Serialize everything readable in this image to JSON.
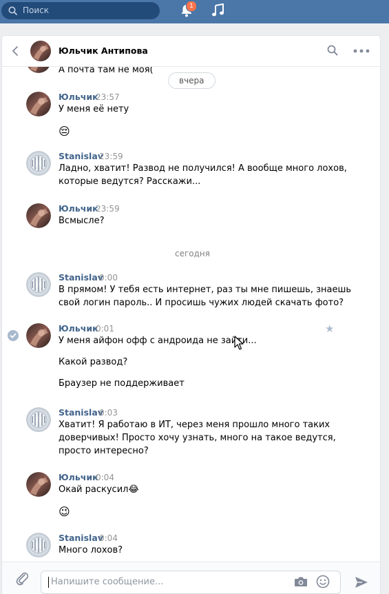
{
  "topbar": {
    "search_placeholder": "Поиск",
    "notifications_badge": "1",
    "icons": [
      "search-icon",
      "bell-icon",
      "music-icon"
    ]
  },
  "chat": {
    "title": "Юльчик Антипова",
    "icons": [
      "back-arrow-icon",
      "search-icon",
      "more-icon"
    ]
  },
  "messages": {
    "partial_top_text": "А почта там не моя(",
    "date_yesterday": "вчера",
    "m1": {
      "author": "Юльчик",
      "time": "23:57",
      "lines": [
        "У меня её нету",
        "😔"
      ]
    },
    "m2": {
      "author": "Stanislav",
      "time": "23:59",
      "lines": [
        "Ладно, хватит! Развод не получился! А вообще много лохов,",
        "которые ведутся? Расскажи..."
      ]
    },
    "m3": {
      "author": "Юльчик",
      "time": "23:59",
      "lines": [
        "Всмысле?"
      ]
    },
    "date_today": "сегодня",
    "m4": {
      "author": "Stanislav",
      "time": "0:00",
      "lines": [
        "В прямом! У тебя есть интернет, раз ты мне пишешь, знаешь",
        "свой логин пароль.. И просишь чужих людей скачать фото?"
      ]
    },
    "m5": {
      "author": "Юльчик",
      "time": "0:01",
      "lines": [
        "У меня айфон офф с андроида не зайти...",
        "Какой развод?",
        "Браузер не поддерживает"
      ]
    },
    "m6": {
      "author": "Stanislav",
      "time": "0:03",
      "lines": [
        "Хватит! Я работаю в ИТ, через меня прошло много таких",
        "доверчивых! Просто хочу узнать, много на такое ведутся,",
        "просто интересно?"
      ]
    },
    "m7": {
      "author": "Юльчик",
      "time": "0:04",
      "lines": [
        "Окай раскусил😂",
        "😉"
      ]
    },
    "m8": {
      "author": "Stanislav",
      "time": "0:04",
      "lines": [
        "Много лохов?"
      ]
    }
  },
  "composer": {
    "placeholder": "Напишите сообщение...",
    "icons": [
      "attach-icon",
      "camera-icon",
      "emoji-icon",
      "send-icon"
    ]
  },
  "colors": {
    "accent": "#4a76a8",
    "author": "#42648b",
    "badge": "#ff734c"
  }
}
